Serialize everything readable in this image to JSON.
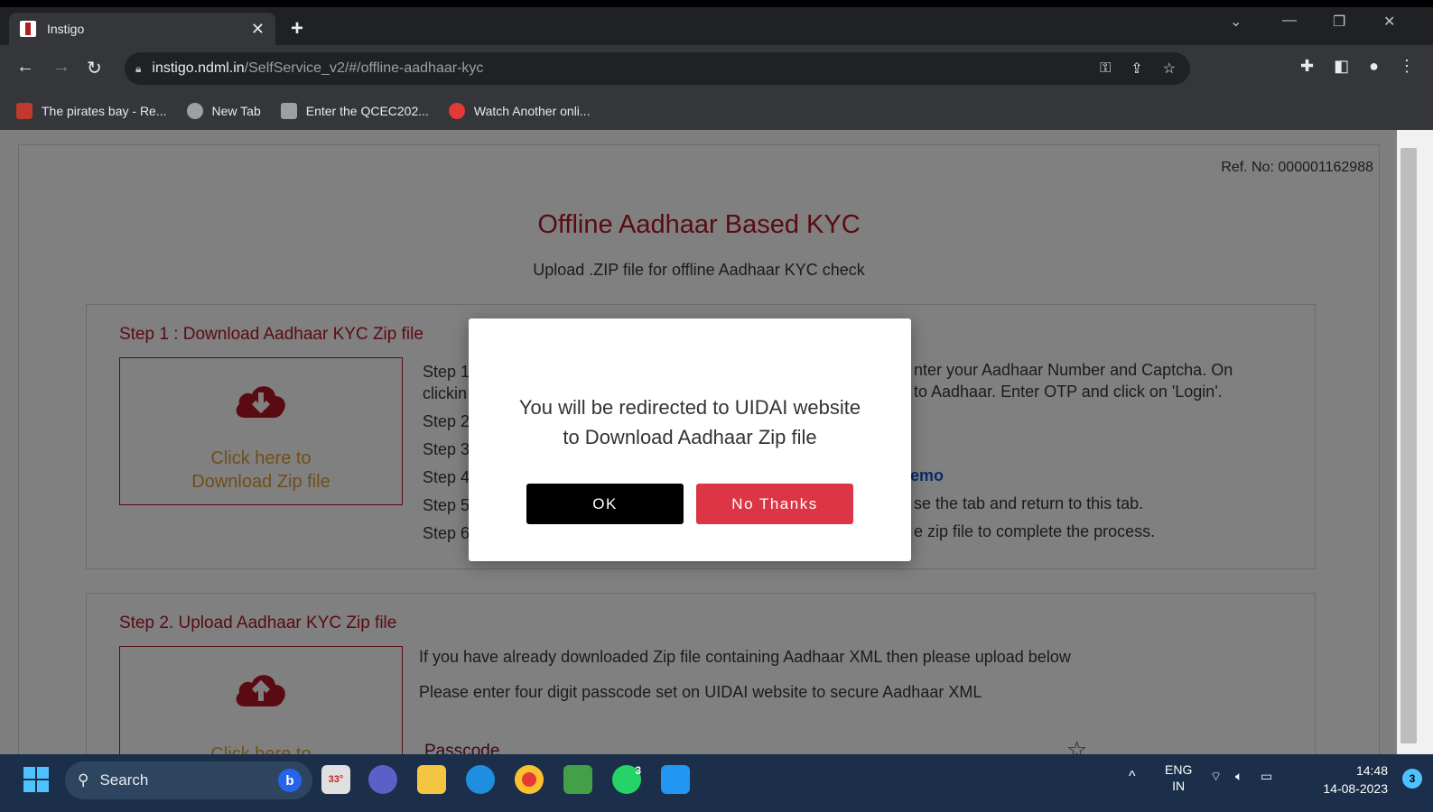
{
  "browser": {
    "tab_title": "Instigo",
    "url_host": "instigo.ndml.in",
    "url_path": "/SelfService_v2/#/offline-aadhaar-kyc",
    "bookmarks": [
      {
        "label": "The pirates bay - Re...",
        "icon": "pirate-icon",
        "color": "#c0392b"
      },
      {
        "label": "New Tab",
        "icon": "globe-icon",
        "color": "#9aa0a6"
      },
      {
        "label": "Enter the QCEC202...",
        "icon": "doc-icon",
        "color": "#9aa0a6"
      },
      {
        "label": "Watch Another onli...",
        "icon": "shield-icon",
        "color": "#e53935"
      }
    ]
  },
  "page": {
    "ref_no": "Ref. No: 000001162988",
    "title": "Offline Aadhaar Based KYC",
    "subtitle": "Upload .ZIP file for offline Aadhaar KYC check",
    "step1": {
      "heading": "Step 1 : Download Aadhaar KYC Zip file",
      "download_line1": "Click here to",
      "download_line2": "Download Zip file",
      "steps_visible": [
        "Step 1",
        "clickin",
        "Step 2",
        "Step 3",
        "Step 4",
        "Step 5",
        "Step 6"
      ],
      "right_line1": "nter your Aadhaar Number and Captcha. On",
      "right_line2": "to Aadhaar. Enter OTP and click on 'Login'.",
      "demo_link": "emo",
      "right_line5": "se the tab and return to this tab.",
      "right_line6": "e zip file to complete the process."
    },
    "step2": {
      "heading": "Step 2. Upload Aadhaar KYC Zip file",
      "upload_line1": "Click here to",
      "info1": "If you have already downloaded Zip file containing Aadhaar XML then please upload below",
      "info2": "Please enter four digit passcode set on UIDAI website to secure Aadhaar XML",
      "passcode_label": "Passcode"
    }
  },
  "modal": {
    "line1": "You will be redirected to UIDAI website",
    "line2": "to Download Aadhaar Zip file",
    "ok_label": "OK",
    "no_label": "No Thanks"
  },
  "taskbar": {
    "search_label": "Search",
    "weather": "33°",
    "lang_line1": "ENG",
    "lang_line2": "IN",
    "time": "14:48",
    "date": "14-08-2023",
    "notifications": "3",
    "whatsapp_badge": "3"
  },
  "colors": {
    "accent_maroon": "#5a0a12",
    "no_thanks_red": "#dc3545",
    "ok_black": "#000000"
  }
}
